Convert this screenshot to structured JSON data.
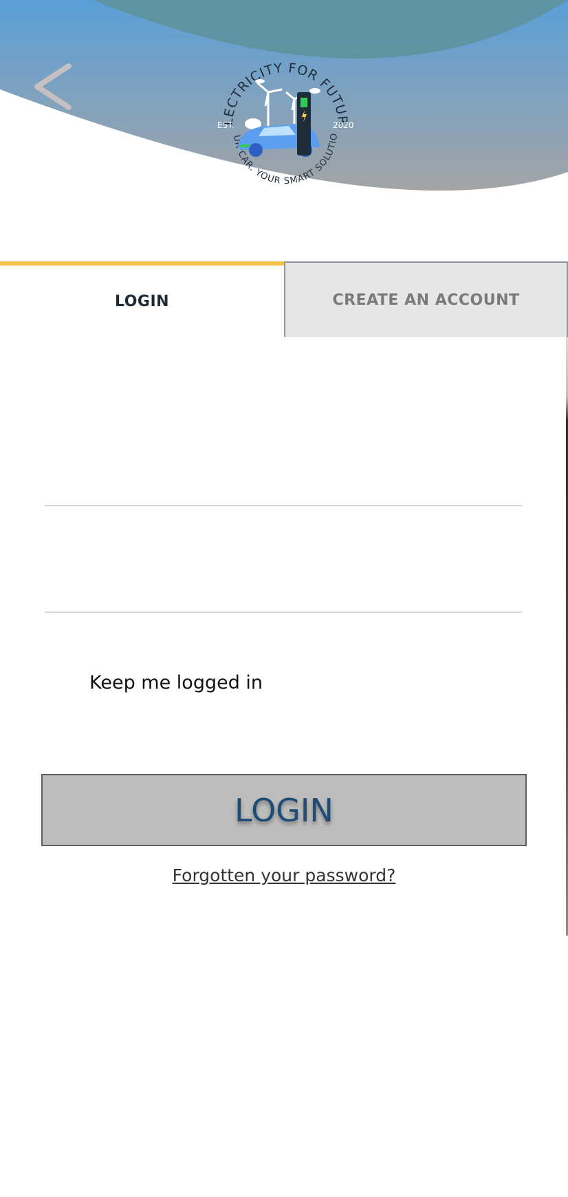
{
  "header": {
    "back_icon": "chevron-left-icon",
    "colors": {
      "arc_top": "#5c9fd6",
      "arc_bottom": "#a1a3a6",
      "inner_arc": "#5c8f94"
    }
  },
  "logo": {
    "ring_top": "ELECTRICITY FOR FUTURE",
    "ring_bottom": "YOUR CAR. YOUR SMART SOLUTION.",
    "left_text": "EST.",
    "right_text": "2020"
  },
  "tabs": [
    {
      "label": "LOGIN",
      "active": true
    },
    {
      "label": "CREATE AN ACCOUNT",
      "active": false
    }
  ],
  "form": {
    "username": {
      "value": "",
      "placeholder": ""
    },
    "password": {
      "value": "",
      "placeholder": ""
    },
    "keep_logged_in_label": "Keep me logged in",
    "submit_label": "LOGIN",
    "forgot_label": "Forgotten your password?"
  },
  "accent_color": "#f0c24a"
}
